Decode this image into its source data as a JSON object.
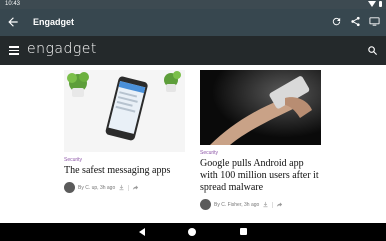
{
  "status_bar": {
    "time": "10:43"
  },
  "app_bar": {
    "title": "Engadget"
  },
  "site_header": {
    "logo_text": "engadget"
  },
  "articles": [
    {
      "category": "Security",
      "headline": "The safest messaging apps",
      "byline": "By C. up, 3h ago"
    },
    {
      "category": "Security",
      "headline": "Google pulls Android app with 100 million users after it spread malware",
      "byline": "By C. Fisher, 3h ago"
    }
  ],
  "colors": {
    "app_bar": "#37474f",
    "site_header": "#24292b",
    "category": "#8e57a8"
  },
  "icons": [
    "back-arrow-icon",
    "refresh-icon",
    "share-icon",
    "cast-icon",
    "hamburger-icon",
    "search-icon",
    "download-icon",
    "share-arrow-icon"
  ]
}
